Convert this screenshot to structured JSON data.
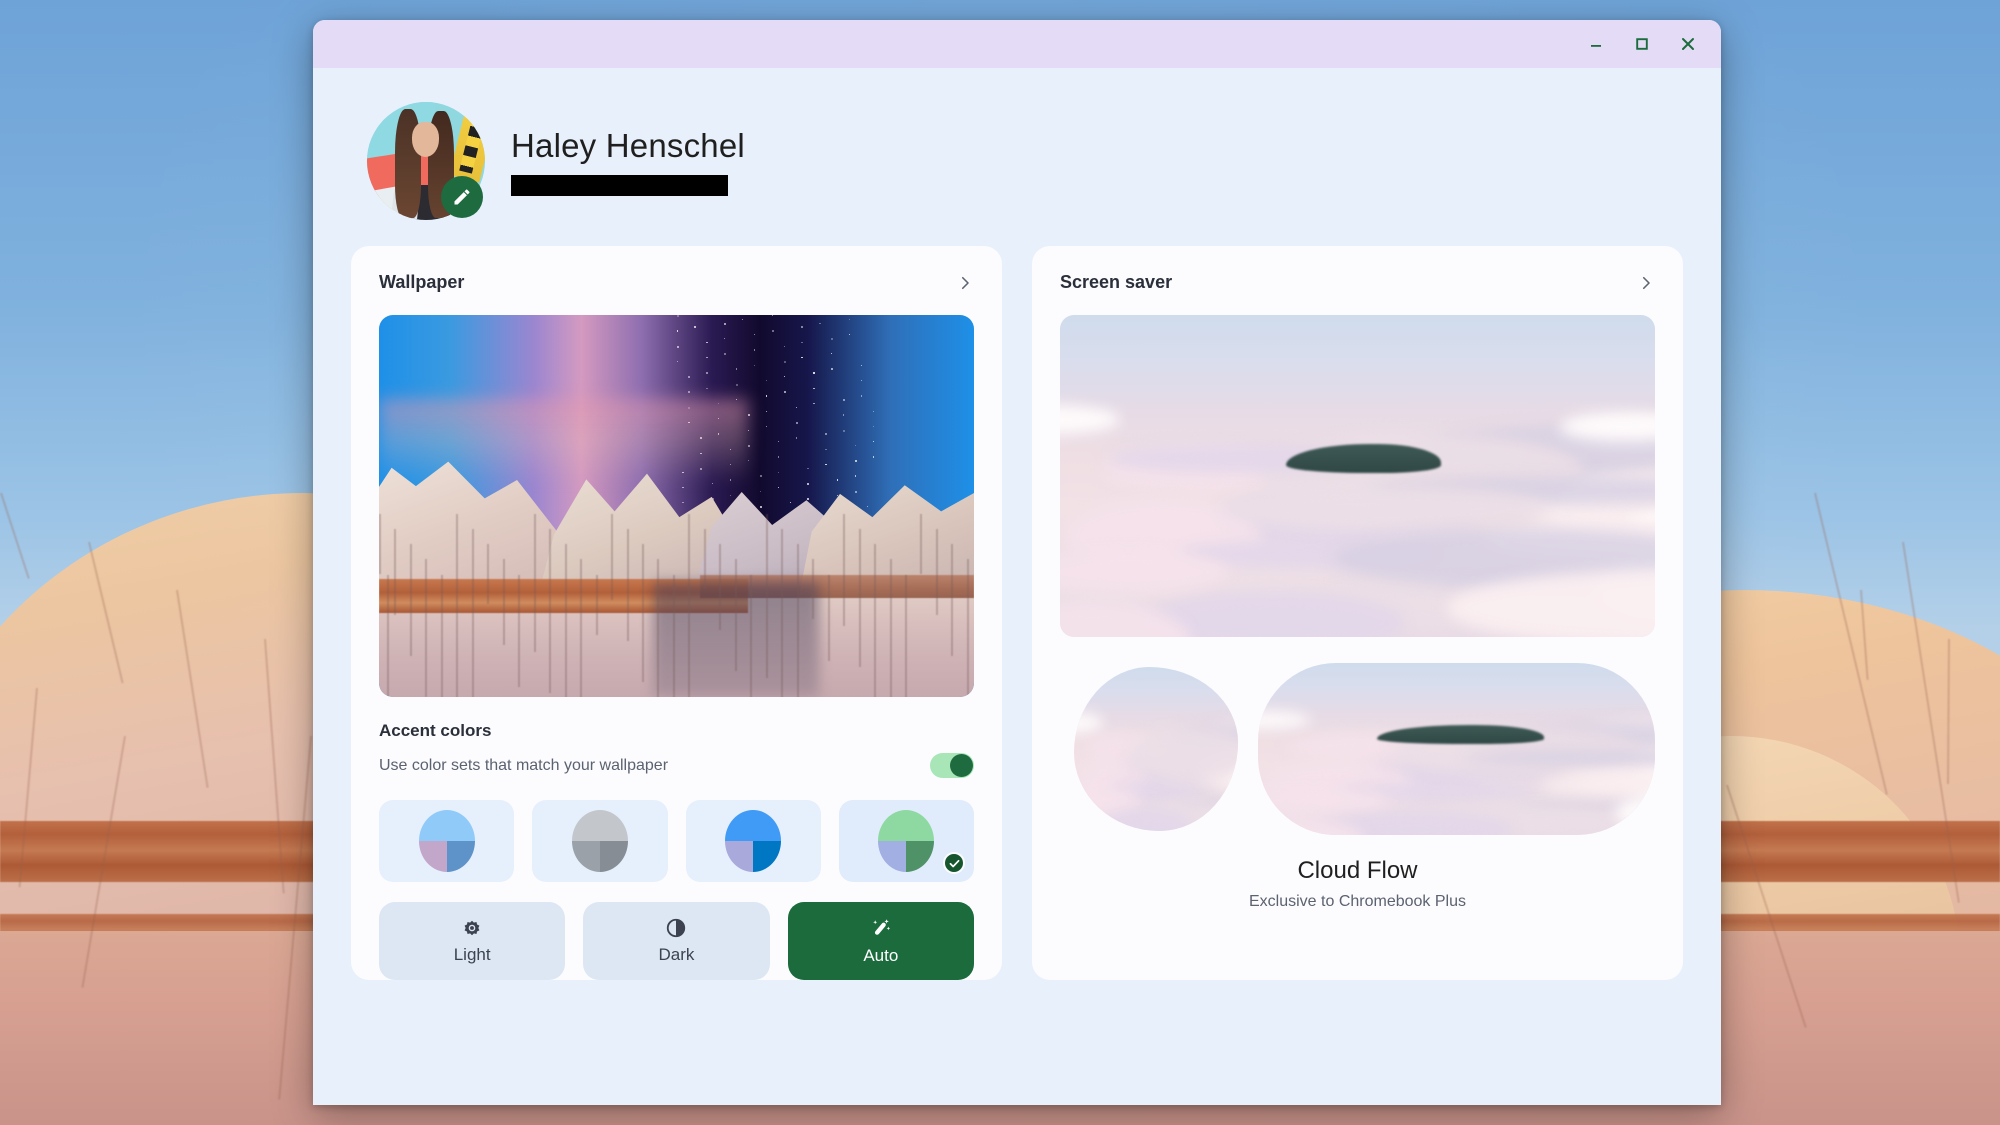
{
  "window": {
    "controls": [
      {
        "name": "minimize",
        "label": "Minimize"
      },
      {
        "name": "maximize",
        "label": "Maximize"
      },
      {
        "name": "close",
        "label": "Close"
      }
    ],
    "titlebar_color": "#e4dcf6",
    "body_color": "#e8f0fb",
    "control_color": "#1b6b3d"
  },
  "profile": {
    "name": "Haley Henschel",
    "email_redacted": true,
    "edit_icon": "pencil-icon",
    "edit_badge_color": "#1e6b3f"
  },
  "wallpaper_card": {
    "title": "Wallpaper",
    "chevron_icon": "chevron-right-icon",
    "accent": {
      "title": "Accent colors",
      "subtitle": "Use color sets that match your wallpaper",
      "toggle_on": true,
      "toggle_track_color": "#a8e6b8",
      "toggle_knob_color": "#1e6b3f",
      "swatches": [
        {
          "name": "swatch-blue-mauve",
          "top": "#90caf9",
          "bottom_left": "#c2a7cb",
          "bottom_right": "#5d93c9",
          "selected": false
        },
        {
          "name": "swatch-grey",
          "top": "#c3c7cc",
          "bottom_left": "#9aa1a8",
          "bottom_right": "#868d94",
          "selected": false
        },
        {
          "name": "swatch-vivid-blue",
          "top": "#3f9bf5",
          "bottom_left": "#a9a9dc",
          "bottom_right": "#0077c2",
          "selected": false
        },
        {
          "name": "swatch-green",
          "top": "#8ed9a2",
          "bottom_left": "#a2afe2",
          "bottom_right": "#4f9268",
          "selected": true
        }
      ],
      "check_icon": "check-icon",
      "check_badge_color": "#16562f"
    },
    "modes": [
      {
        "name": "light",
        "label": "Light",
        "icon": "sun-icon",
        "active": false
      },
      {
        "name": "dark",
        "label": "Dark",
        "icon": "contrast-icon",
        "active": false
      },
      {
        "name": "auto",
        "label": "Auto",
        "icon": "magic-wand-icon",
        "active": true
      }
    ],
    "mode_active_color": "#1b6b3d"
  },
  "screensaver_card": {
    "title": "Screen saver",
    "chevron_icon": "chevron-right-icon",
    "collection_name": "Cloud Flow",
    "collection_subtitle": "Exclusive to Chromebook Plus",
    "thumbnails": [
      {
        "name": "thumbnail-cloud-blob",
        "shape": "blob"
      },
      {
        "name": "thumbnail-cloud-pill",
        "shape": "pill"
      }
    ]
  }
}
